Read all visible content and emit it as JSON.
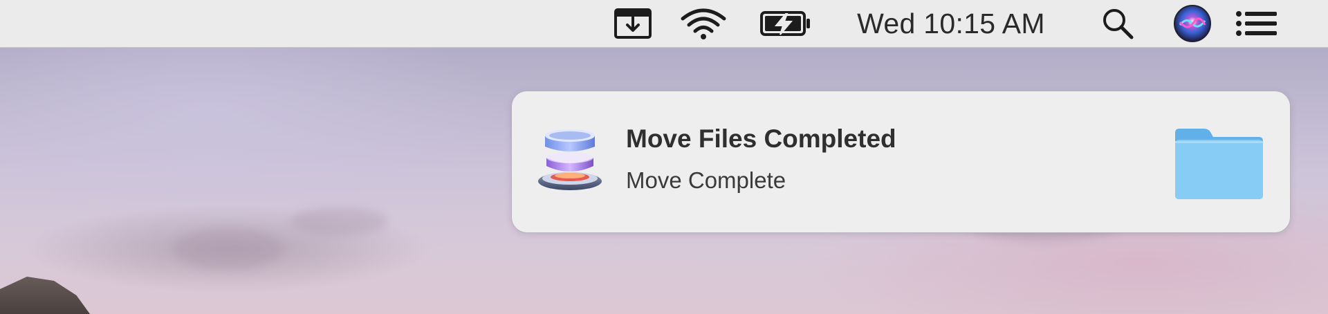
{
  "menubar": {
    "icons": [
      "download-icon",
      "wifi-icon",
      "battery-charging-icon",
      "search-icon",
      "siri-icon",
      "list-icon"
    ],
    "clock": "Wed 10:15 AM"
  },
  "notification": {
    "title": "Move Files Completed",
    "body": "Move Complete",
    "app_icon": "disk-stack-icon",
    "attachment_icon": "folder-icon"
  },
  "colors": {
    "menubar_bg": "#ebebeb",
    "folder_blue": "#7fc4f0"
  }
}
